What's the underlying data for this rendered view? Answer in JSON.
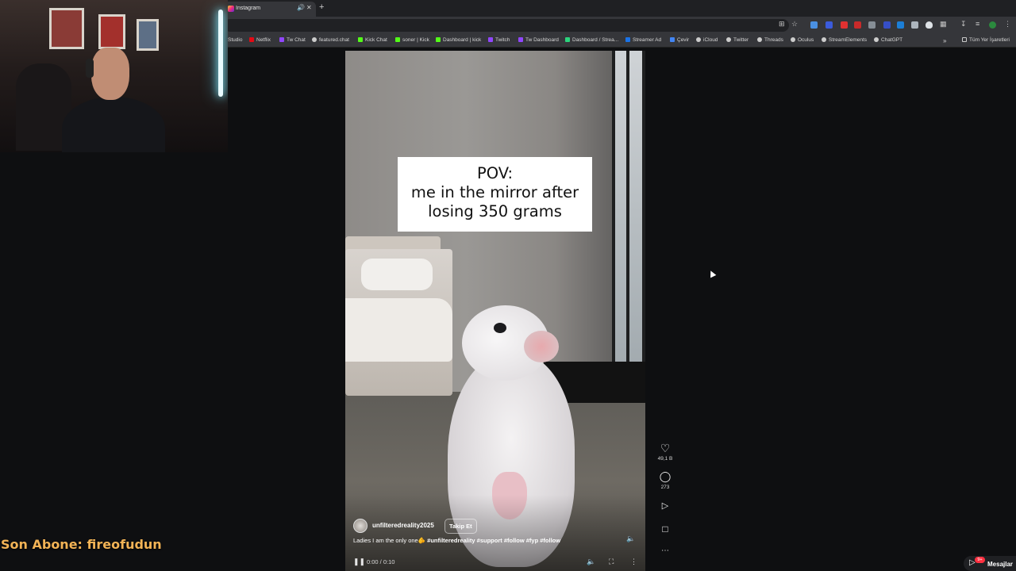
{
  "browser": {
    "tab": {
      "title": "Instagram"
    },
    "bookmarks": [
      {
        "label": "Studio",
        "color": "#ff0000"
      },
      {
        "label": "Netflix",
        "color": "#e50914"
      },
      {
        "label": "Tw Chat",
        "color": "#9146ff"
      },
      {
        "label": "featured.chat",
        "color": "#cccccc"
      },
      {
        "label": "Kick Chat",
        "color": "#53fc18"
      },
      {
        "label": "soner | Kick",
        "color": "#53fc18"
      },
      {
        "label": "Dashboard | kick",
        "color": "#53fc18"
      },
      {
        "label": "Twitch",
        "color": "#9146ff"
      },
      {
        "label": "Tw Dashboard",
        "color": "#9146ff"
      },
      {
        "label": "Dashboard / Strea...",
        "color": "#2bd47d"
      },
      {
        "label": "Streamer Ad",
        "color": "#1a73e8"
      },
      {
        "label": "Çevir",
        "color": "#4285f4"
      },
      {
        "label": "iCloud",
        "color": "#cccccc"
      },
      {
        "label": "Twitter",
        "color": "#cccccc"
      },
      {
        "label": "Threads",
        "color": "#cccccc"
      },
      {
        "label": "Oculus",
        "color": "#cccccc"
      },
      {
        "label": "StreamElements",
        "color": "#cccccc"
      },
      {
        "label": "ChatGPT",
        "color": "#cccccc"
      }
    ],
    "all_bookmarks": "Tüm Yer İşaretleri"
  },
  "overlay": {
    "last_sub": "Son Abone: fireofudun"
  },
  "reel": {
    "caption_lines": [
      "POV:",
      "me in the mirror after",
      "losing 350 grams"
    ],
    "username": "unfilteredreality2025",
    "follow_label": "Takip Et",
    "description_text": "Ladies I am the only one🫵 ",
    "description_tags": "#unfilteredreality #support #follow #fyp #follow",
    "time": "0:00 / 0:10",
    "playback_progress": 0
  },
  "actions": {
    "likes": "49,1 B",
    "comments": "273"
  },
  "messages": {
    "label": "Mesajlar",
    "badge": "9+"
  }
}
